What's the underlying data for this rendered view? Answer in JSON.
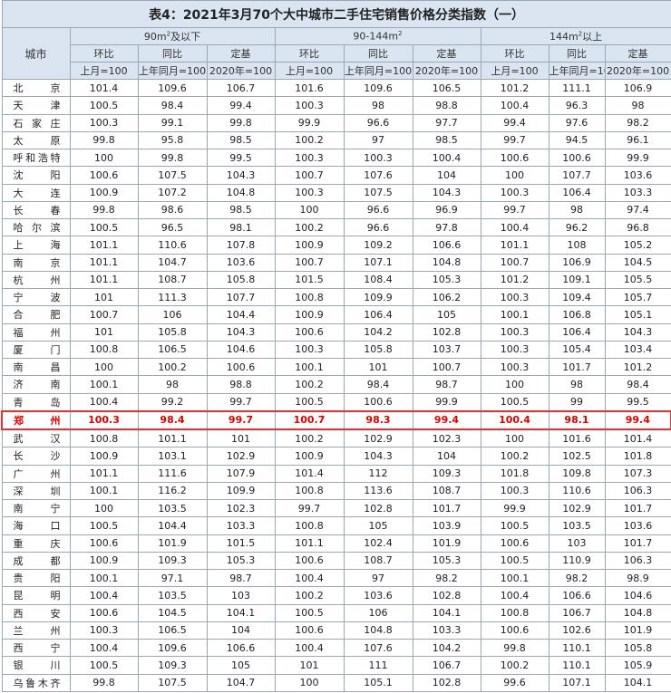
{
  "title": "表4：2021年3月70个大中城市二手住宅销售价格分类指数（一）",
  "header": {
    "city": "城市",
    "groups": [
      {
        "area": "90m",
        "sup": "2",
        "suffix": "及以下"
      },
      {
        "area": "90-144m",
        "sup": "2",
        "suffix": ""
      },
      {
        "area": "144m",
        "sup": "2",
        "suffix": "以上"
      }
    ],
    "subcols": [
      "环比",
      "同比",
      "定基"
    ],
    "bases": [
      "上月=100",
      "上年同月=100",
      "2020年=100"
    ]
  },
  "highlight_city": "郑州",
  "rows": [
    {
      "city": "北京",
      "v": [
        "101.4",
        "109.6",
        "106.7",
        "101.6",
        "109.6",
        "106.5",
        "101.2",
        "111.1",
        "106.9"
      ]
    },
    {
      "city": "天津",
      "v": [
        "100.5",
        "98.4",
        "99.4",
        "100.3",
        "98",
        "98.8",
        "100.4",
        "96.3",
        "98"
      ]
    },
    {
      "city": "石家庄",
      "v": [
        "100.3",
        "99.1",
        "99.8",
        "99.9",
        "96.6",
        "97.7",
        "99.4",
        "97.6",
        "98.2"
      ]
    },
    {
      "city": "太原",
      "v": [
        "99.8",
        "95.8",
        "98.5",
        "100.2",
        "97",
        "98.5",
        "99.7",
        "94.5",
        "96.1"
      ]
    },
    {
      "city": "呼和浩特",
      "v": [
        "100",
        "99.8",
        "99.5",
        "100.3",
        "100.3",
        "100.4",
        "100.6",
        "100.6",
        "99.9"
      ]
    },
    {
      "city": "沈阳",
      "v": [
        "100.6",
        "107.5",
        "104.3",
        "100.7",
        "107.6",
        "104",
        "100",
        "107.7",
        "103.6"
      ]
    },
    {
      "city": "大连",
      "v": [
        "100.9",
        "107.2",
        "104.8",
        "100.3",
        "107.5",
        "104.3",
        "100.3",
        "106.4",
        "103.3"
      ]
    },
    {
      "city": "长春",
      "v": [
        "99.8",
        "98.6",
        "98.5",
        "100",
        "96.6",
        "96.9",
        "99.7",
        "98",
        "97.4"
      ]
    },
    {
      "city": "哈尔滨",
      "v": [
        "100.5",
        "96.5",
        "98.1",
        "100.2",
        "96.6",
        "97.8",
        "100.4",
        "96.2",
        "96.8"
      ]
    },
    {
      "city": "上海",
      "v": [
        "101.1",
        "110.6",
        "107.8",
        "100.9",
        "109.2",
        "106.6",
        "101.1",
        "108",
        "105.2"
      ]
    },
    {
      "city": "南京",
      "v": [
        "101.1",
        "104.7",
        "103.6",
        "100.7",
        "107.1",
        "104.8",
        "100.7",
        "106.9",
        "104.5"
      ]
    },
    {
      "city": "杭州",
      "v": [
        "101.1",
        "108.7",
        "105.8",
        "101.5",
        "108.4",
        "105.3",
        "101.2",
        "109.1",
        "105.5"
      ]
    },
    {
      "city": "宁波",
      "v": [
        "101",
        "111.3",
        "107.7",
        "100.8",
        "109.9",
        "106.2",
        "100.3",
        "109.4",
        "105.7"
      ]
    },
    {
      "city": "合肥",
      "v": [
        "100.7",
        "106",
        "104.4",
        "100.9",
        "106.4",
        "105",
        "100.1",
        "106.8",
        "105.1"
      ]
    },
    {
      "city": "福州",
      "v": [
        "101",
        "105.8",
        "104.3",
        "100.6",
        "104.2",
        "102.8",
        "100.3",
        "106.4",
        "104.3"
      ]
    },
    {
      "city": "厦门",
      "v": [
        "100.8",
        "106.5",
        "104.6",
        "100.3",
        "105.8",
        "103.7",
        "100.3",
        "105.4",
        "103.4"
      ]
    },
    {
      "city": "南昌",
      "v": [
        "100",
        "100.2",
        "100.6",
        "100.1",
        "101",
        "100.7",
        "100.3",
        "101.7",
        "101.2"
      ]
    },
    {
      "city": "济南",
      "v": [
        "100.1",
        "98",
        "98.8",
        "100.2",
        "98.4",
        "98.7",
        "100",
        "98",
        "98.4"
      ]
    },
    {
      "city": "青岛",
      "v": [
        "100.4",
        "99.2",
        "99.7",
        "100.5",
        "100.6",
        "99.9",
        "100.5",
        "99",
        "99.5"
      ]
    },
    {
      "city": "郑州",
      "v": [
        "100.3",
        "98.4",
        "99.7",
        "100.7",
        "98.3",
        "99.4",
        "100.4",
        "98.1",
        "99.4"
      ]
    },
    {
      "city": "武汉",
      "v": [
        "100.8",
        "101.1",
        "101",
        "100.2",
        "102.9",
        "102.3",
        "100",
        "101.6",
        "101.4"
      ]
    },
    {
      "city": "长沙",
      "v": [
        "100.9",
        "103.1",
        "102.9",
        "100.9",
        "104.3",
        "104",
        "100.2",
        "102.5",
        "101.8"
      ]
    },
    {
      "city": "广州",
      "v": [
        "101.1",
        "111.6",
        "107.9",
        "101.4",
        "112",
        "109.3",
        "101.8",
        "109.8",
        "107.3"
      ]
    },
    {
      "city": "深圳",
      "v": [
        "100.1",
        "116.2",
        "109.9",
        "100.8",
        "113.6",
        "108.7",
        "100.3",
        "110.6",
        "106.3"
      ]
    },
    {
      "city": "南宁",
      "v": [
        "100",
        "103.5",
        "102.3",
        "99.7",
        "102.8",
        "101.7",
        "99.9",
        "102.9",
        "101.7"
      ]
    },
    {
      "city": "海口",
      "v": [
        "100.5",
        "104.4",
        "103.3",
        "100.8",
        "105",
        "103.9",
        "100.5",
        "103.5",
        "103.6"
      ]
    },
    {
      "city": "重庆",
      "v": [
        "100.6",
        "101.9",
        "101.5",
        "101.1",
        "102.4",
        "101.9",
        "100.6",
        "103",
        "101.7"
      ]
    },
    {
      "city": "成都",
      "v": [
        "100.9",
        "109.3",
        "105.3",
        "100.6",
        "108.7",
        "105.3",
        "100.5",
        "110.9",
        "106.3"
      ]
    },
    {
      "city": "贵阳",
      "v": [
        "100.1",
        "97.1",
        "98.7",
        "100.4",
        "97",
        "98.2",
        "100.1",
        "98.2",
        "98.9"
      ]
    },
    {
      "city": "昆明",
      "v": [
        "100.4",
        "103.5",
        "103",
        "100.2",
        "103.6",
        "102.8",
        "100.4",
        "106.6",
        "104.6"
      ]
    },
    {
      "city": "西安",
      "v": [
        "100.6",
        "104.5",
        "104.1",
        "100.5",
        "106",
        "104.1",
        "100.8",
        "106.7",
        "104.8"
      ]
    },
    {
      "city": "兰州",
      "v": [
        "100.3",
        "106.5",
        "104",
        "100.6",
        "104.8",
        "103.3",
        "100.6",
        "102.6",
        "101.9"
      ]
    },
    {
      "city": "西宁",
      "v": [
        "100.4",
        "109.6",
        "106.6",
        "100.4",
        "107.6",
        "104.2",
        "99.8",
        "110.1",
        "105.8"
      ]
    },
    {
      "city": "银川",
      "v": [
        "100.5",
        "109.3",
        "105",
        "101",
        "111",
        "106.7",
        "100.2",
        "110.1",
        "105.9"
      ]
    },
    {
      "city": "乌鲁木齐",
      "v": [
        "99.8",
        "107.5",
        "104.7",
        "100",
        "105.1",
        "102.8",
        "99.6",
        "107.1",
        "104.1"
      ]
    }
  ]
}
